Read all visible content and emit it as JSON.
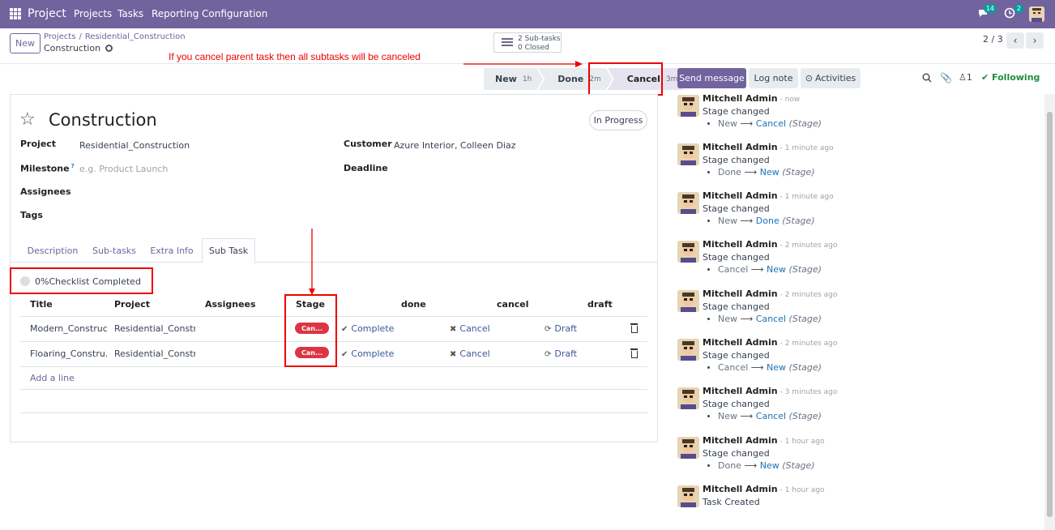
{
  "navbar": {
    "brand": "Project",
    "menu": [
      "Projects",
      "Tasks",
      "Reporting",
      "Configuration"
    ],
    "messages_count": "14",
    "activities_count": "2"
  },
  "control_panel": {
    "new_label": "New",
    "breadcrumb_parent": "Projects",
    "breadcrumb_project": "Residential_Construction",
    "breadcrumb_current": "Construction",
    "subtasks_count": "2 Sub-tasks",
    "subtasks_closed": "0 Closed",
    "pager": "2 / 3"
  },
  "annotation": "If you cancel parent task then all subtasks  will be canceled",
  "stages": [
    {
      "label": "New",
      "time": "1h"
    },
    {
      "label": "Done",
      "time": "2m"
    },
    {
      "label": "Cancel",
      "time": "3m"
    }
  ],
  "task": {
    "title": "Construction",
    "status": "In Progress",
    "project_label": "Project",
    "project_value": "Residential_Construction",
    "milestone_label": "Milestone",
    "milestone_placeholder": "e.g. Product Launch",
    "assignees_label": "Assignees",
    "tags_label": "Tags",
    "customer_label": "Customer",
    "customer_value": "Azure Interior, Colleen Diaz",
    "deadline_label": "Deadline"
  },
  "tabs": [
    "Description",
    "Sub-tasks",
    "Extra Info",
    "Sub Task"
  ],
  "checklist": "0%Checklist Completed",
  "table": {
    "headers": [
      "Title",
      "Project",
      "Assignees",
      "Stage",
      "done",
      "cancel",
      "draft"
    ],
    "rows": [
      {
        "title": "Modern_Construc...",
        "project": "Residential_Constr...",
        "stage": "Can...",
        "done": "Complete",
        "cancel": "Cancel",
        "draft": "Draft"
      },
      {
        "title": "Floaring_Constru...",
        "project": "Residential_Constr...",
        "stage": "Can...",
        "done": "Complete",
        "cancel": "Cancel",
        "draft": "Draft"
      }
    ],
    "add_line": "Add a line"
  },
  "chatter": {
    "send_message": "Send message",
    "log_note": "Log note",
    "activities": "Activities",
    "followers": "1",
    "following": "Following",
    "messages": [
      {
        "author": "Mitchell Admin",
        "time": "- now",
        "body": "Stage changed",
        "from": "New",
        "to": "Cancel",
        "field": "(Stage)"
      },
      {
        "author": "Mitchell Admin",
        "time": "- 1 minute ago",
        "body": "Stage changed",
        "from": "Done",
        "to": "New",
        "field": "(Stage)"
      },
      {
        "author": "Mitchell Admin",
        "time": "- 1 minute ago",
        "body": "Stage changed",
        "from": "New",
        "to": "Done",
        "field": "(Stage)"
      },
      {
        "author": "Mitchell Admin",
        "time": "- 2 minutes ago",
        "body": "Stage changed",
        "from": "Cancel",
        "to": "New",
        "field": "(Stage)"
      },
      {
        "author": "Mitchell Admin",
        "time": "- 2 minutes ago",
        "body": "Stage changed",
        "from": "New",
        "to": "Cancel",
        "field": "(Stage)"
      },
      {
        "author": "Mitchell Admin",
        "time": "- 2 minutes ago",
        "body": "Stage changed",
        "from": "Cancel",
        "to": "New",
        "field": "(Stage)"
      },
      {
        "author": "Mitchell Admin",
        "time": "- 3 minutes ago",
        "body": "Stage changed",
        "from": "New",
        "to": "Cancel",
        "field": "(Stage)"
      },
      {
        "author": "Mitchell Admin",
        "time": "- 1 hour ago",
        "body": "Stage changed",
        "from": "Done",
        "to": "New",
        "field": "(Stage)"
      },
      {
        "author": "Mitchell Admin",
        "time": "- 1 hour ago",
        "body": "Task Created"
      }
    ]
  },
  "colors": {
    "brand": "#71639e",
    "annotation": "#ee0000",
    "cancel_badge": "#dc3545",
    "link": "#1a73b8"
  }
}
